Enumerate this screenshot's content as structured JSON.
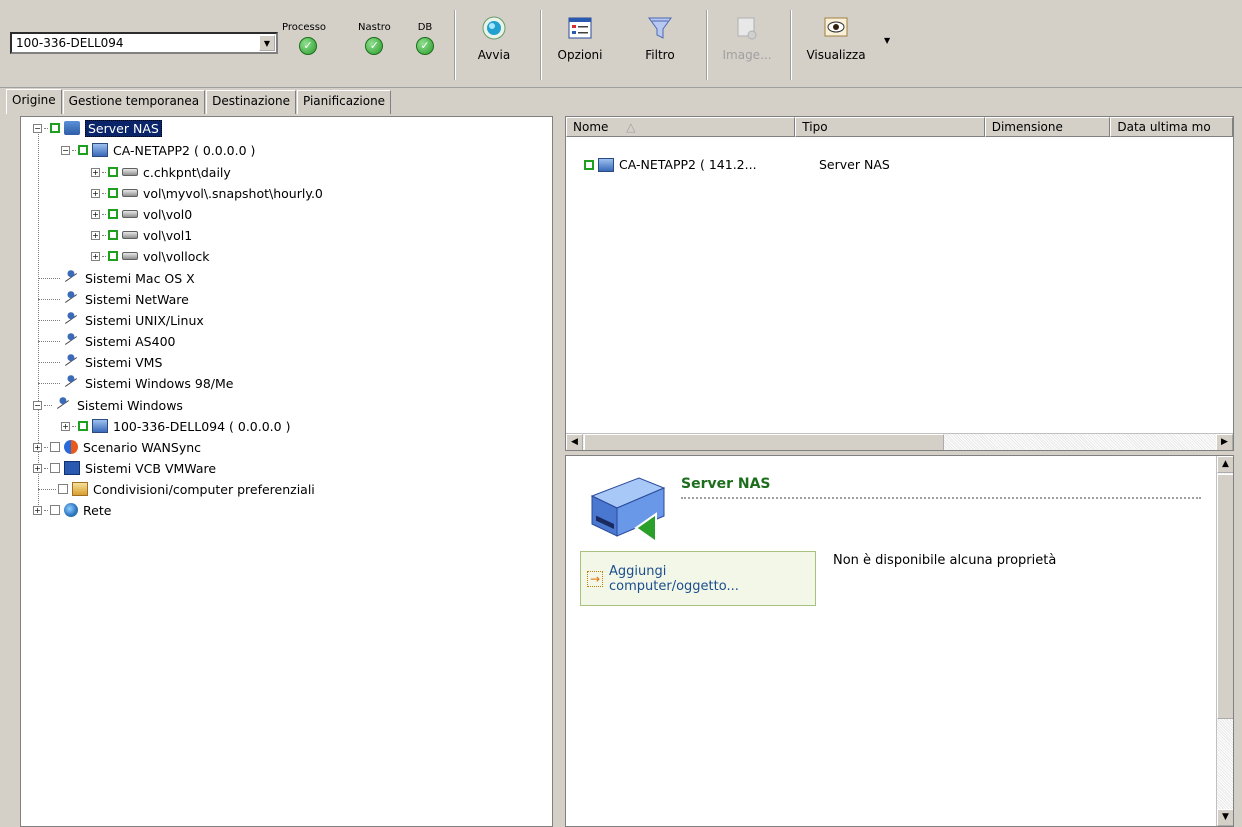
{
  "toolbar": {
    "server_selected": "100-336-DELL094",
    "status": [
      {
        "label": "Processo"
      },
      {
        "label": "Nastro"
      },
      {
        "label": "DB"
      }
    ],
    "buttons": {
      "avvia": "Avvia",
      "opzioni": "Opzioni",
      "filtro": "Filtro",
      "image": "Image...",
      "visualizza": "Visualizza"
    }
  },
  "tabs": [
    "Origine",
    "Gestione temporanea",
    "Destinazione",
    "Pianificazione"
  ],
  "tree": {
    "server_nas": "Server NAS",
    "netapp": "CA-NETAPP2 ( 0.0.0.0 )",
    "volumes": [
      "c.chkpnt\\daily",
      "vol\\myvol\\.snapshot\\hourly.0",
      "vol\\vol0",
      "vol\\vol1",
      "vol\\vollock"
    ],
    "systems": [
      "Sistemi Mac OS X",
      "Sistemi NetWare",
      "Sistemi UNIX/Linux",
      "Sistemi AS400",
      "Sistemi VMS",
      "Sistemi Windows 98/Me"
    ],
    "windows": "Sistemi Windows",
    "windows_child": "100-336-DELL094 ( 0.0.0.0 )",
    "wansync": "Scenario WANSync",
    "vmware": "Sistemi VCB VMWare",
    "shares": "Condivisioni/computer preferenziali",
    "rete": "Rete"
  },
  "list": {
    "columns": [
      "Nome",
      "Tipo",
      "Dimensione",
      "Data ultima mo"
    ],
    "rows": [
      {
        "name": "CA-NETAPP2 ( 141.2...",
        "type": "Server NAS"
      }
    ]
  },
  "detail": {
    "title": "Server NAS",
    "add_label": "Aggiungi computer/oggetto...",
    "no_property": "Non è disponibile alcuna proprietà"
  },
  "colors": {
    "selection": "#0a246a",
    "check_green": "#1ea01e",
    "detail_title": "#1c6e1c"
  }
}
